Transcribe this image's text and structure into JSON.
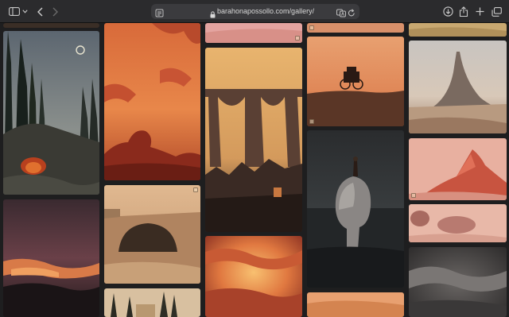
{
  "browser": {
    "url": "barahonapossollo.com/gallery/",
    "icons": {
      "sidebar": "sidebar-icon",
      "chevron": "chevron-down-icon",
      "back": "back-arrow-icon",
      "forward": "forward-arrow-icon",
      "reader": "reader-icon",
      "lock": "lock-icon",
      "translate": "translate-icon",
      "reload": "reload-icon",
      "downloads": "download-icon",
      "share": "share-icon",
      "new_tab": "plus-icon",
      "tabs": "tab-overview-icon"
    }
  },
  "gallery": {
    "artworks": [
      {
        "id": "cypress-cave-night"
      },
      {
        "id": "red-sky-rock-arch"
      },
      {
        "id": "strip-top-col3"
      },
      {
        "id": "stone-aqueduct"
      },
      {
        "id": "ruined-towers-dusk"
      },
      {
        "id": "fiery-clouds"
      },
      {
        "id": "stagecoach-hill"
      },
      {
        "id": "stone-head-sea"
      },
      {
        "id": "desert-valley"
      },
      {
        "id": "needle-rock"
      },
      {
        "id": "jagged-rocks-pink"
      },
      {
        "id": "boulders-pink"
      },
      {
        "id": "grey-smoke"
      },
      {
        "id": "stone-arch-ruin"
      },
      {
        "id": "village-cypress"
      },
      {
        "id": "orange-clouds-col4"
      },
      {
        "id": "sunset-clouds-col1"
      }
    ]
  }
}
